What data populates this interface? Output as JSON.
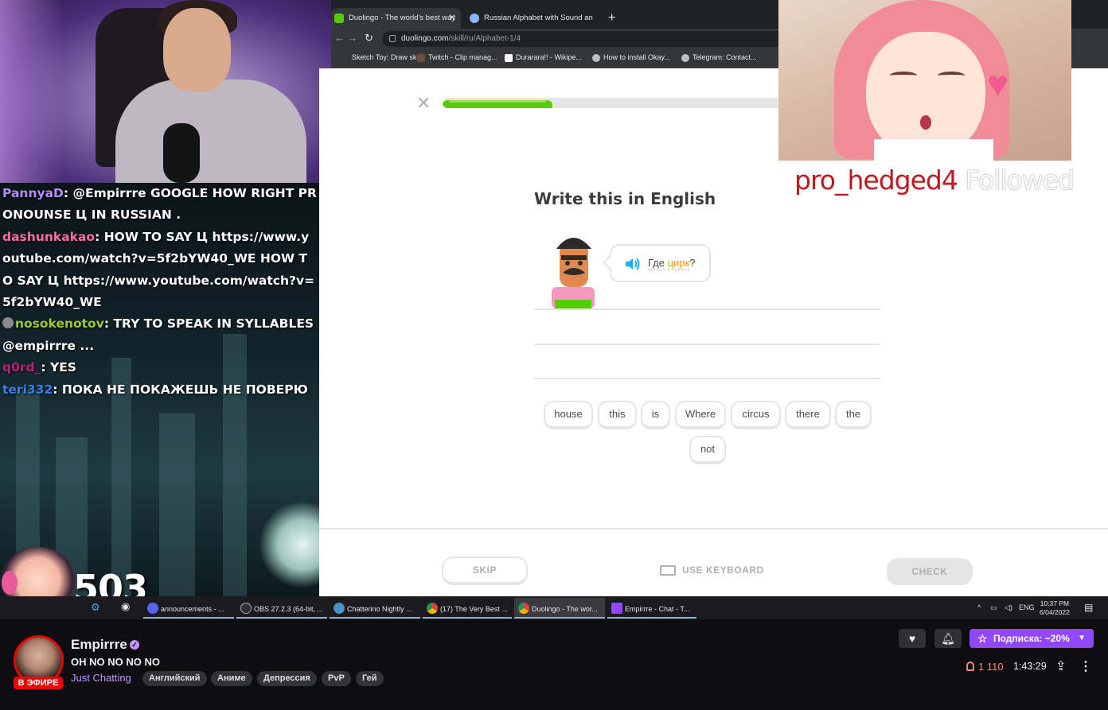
{
  "chat": {
    "lines": [
      {
        "user": "PannyaD",
        "color": "#b68cf5",
        "text": "@Empirrre GOOGLE HOW RIGHT PRONOUNSE Ц IN RUSSIAN ."
      },
      {
        "user": "dashunkakao",
        "color": "#ff6ea6",
        "text": "HOW TO SAY Ц https://www.youtube.com/watch?v=5f2bYW40_WE HOW TO SAY Ц https://www.youtube.com/watch?v=5f2bYW40_WE"
      },
      {
        "user": "nosokenotov",
        "color": "#9acd32",
        "text": "TRY TO SPEAK IN SYLLABLES @empirrre ..."
      },
      {
        "user": "q0rd_",
        "color": "#b8237a",
        "text": "YES"
      },
      {
        "user": "teri332",
        "color": "#3a7ff0",
        "text": "ПОКА НЕ ПОКАЖЕШЬ НЕ ПОВЕРЮ"
      }
    ]
  },
  "overlay": {
    "viewer_number": "503",
    "follow_alert_name": "pro_hedged4",
    "follow_alert_text": "Followed"
  },
  "browser": {
    "tabs": [
      {
        "label": "Duolingo - The world's best way",
        "color": "#58cc02",
        "active": true
      },
      {
        "label": "Russian Alphabet with Sound an",
        "color": "#8ab4f8",
        "active": false
      }
    ],
    "url_host": "duolingo.com",
    "url_path": "/skill/ru/Alphabet-1/4",
    "bookmarks": [
      "Sketch Toy: Draw sk...",
      "Twitch - Clip manag...",
      "Durarara!! - Wikipe...",
      "How to install Okay...",
      "Telegram: Contact..."
    ]
  },
  "duolingo": {
    "progress": 0.32,
    "title": "Write this in English",
    "prompt_word_1": "Где",
    "prompt_word_2": "цирк",
    "prompt_end": "?",
    "word_bank": [
      "house",
      "this",
      "is",
      "Where",
      "circus",
      "there",
      "the",
      "not"
    ],
    "skip_label": "SKIP",
    "keyboard_label": "USE KEYBOARD",
    "check_label": "CHECK"
  },
  "taskbar": {
    "items": [
      {
        "label": "announcements - ...",
        "color": "#5865f2"
      },
      {
        "label": "OBS 27.2.3 (64-bit, ...",
        "color": "#302e31"
      },
      {
        "label": "Chatterino Nightly ...",
        "color": "#4a90c2"
      },
      {
        "label": "(17) The Very Best ...",
        "color": "#db4437"
      },
      {
        "label": "Duolingo - The wor...",
        "color": "#db4437"
      },
      {
        "label": "Empirrre - Chat - T...",
        "color": "#9147ff"
      }
    ],
    "lang": "ENG",
    "time": "10:37 PM",
    "date": "6/04/2022"
  },
  "stream": {
    "streamer": "Empirrre",
    "live_badge": "В ЭФИРЕ",
    "title": "OH NO NO NO NO",
    "category": "Just Chatting",
    "tags": [
      "Английский",
      "Аниме",
      "Депрессия",
      "PvP",
      "Гей"
    ],
    "subscribe_label": "Подписка: −20%",
    "viewers": "1 110",
    "uptime": "1:43:29"
  }
}
